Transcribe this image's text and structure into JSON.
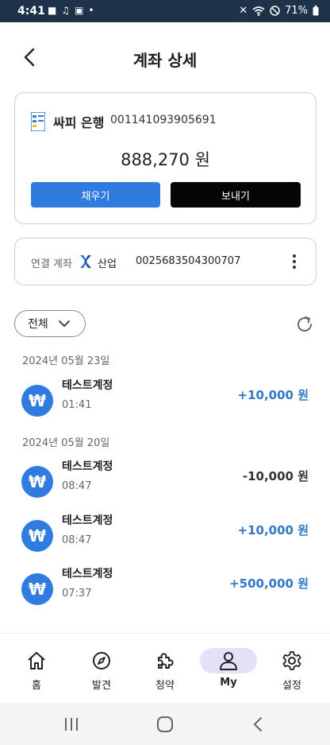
{
  "status_bar": {
    "time": "4:41",
    "battery": "71%"
  },
  "header": {
    "title": "계좌 상세"
  },
  "account": {
    "bank_name": "싸피 은행",
    "account_number": "001141093905691",
    "balance": "888,270 원",
    "charge_label": "채우기",
    "send_label": "보내기"
  },
  "linked": {
    "label": "연결 계좌",
    "bank": "산업",
    "number": "0025683504300707"
  },
  "filter": {
    "label": "전체"
  },
  "transactions": {
    "groups": [
      {
        "date": "2024년 05월 23일",
        "items": [
          {
            "name": "테스트계정",
            "time": "01:41",
            "amount": "+10,000 원"
          }
        ]
      },
      {
        "date": "2024년 05월 20일",
        "items": [
          {
            "name": "테스트계정",
            "time": "08:47",
            "amount": "-10,000 원"
          },
          {
            "name": "테스트계정",
            "time": "08:47",
            "amount": "+10,000 원"
          },
          {
            "name": "테스트계정",
            "time": "07:37",
            "amount": "+500,000 원"
          }
        ]
      }
    ],
    "won_symbol": "₩"
  },
  "bottom_nav": {
    "items": [
      {
        "label": "홈",
        "icon": "home-icon"
      },
      {
        "label": "발견",
        "icon": "compass-icon"
      },
      {
        "label": "청약",
        "icon": "puzzle-icon"
      },
      {
        "label": "My",
        "icon": "person-icon",
        "active": true
      },
      {
        "label": "설정",
        "icon": "gear-icon"
      }
    ]
  },
  "colors": {
    "accent": "#2f7be0",
    "positive_amount": "#2f78c8",
    "status_bar": "#1e3249",
    "active_nav_bg": "#e5e0f8"
  }
}
